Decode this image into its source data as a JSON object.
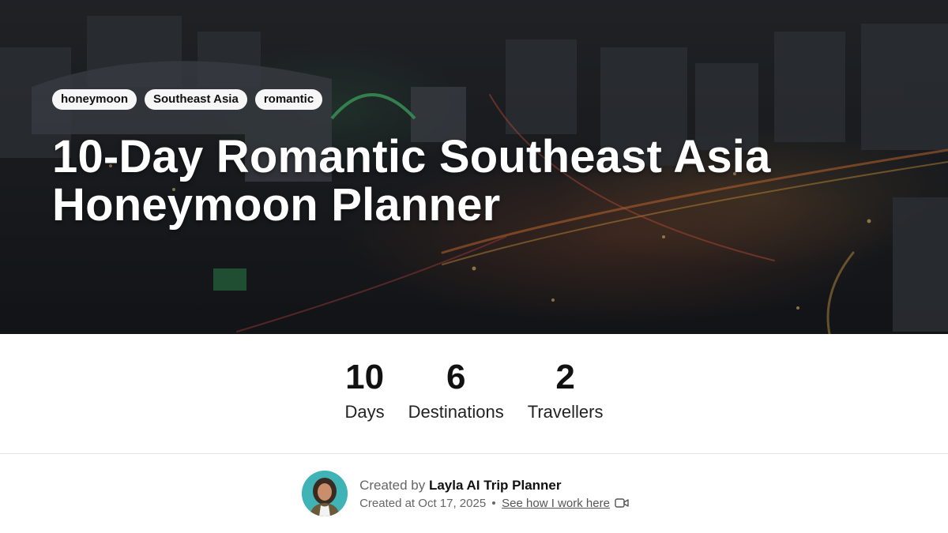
{
  "hero": {
    "tags": [
      "honeymoon",
      "Southeast Asia",
      "romantic"
    ],
    "title": "10-Day Romantic Southeast Asia Honeymoon Planner"
  },
  "stats": [
    {
      "value": "10",
      "label": "Days"
    },
    {
      "value": "6",
      "label": "Destinations"
    },
    {
      "value": "2",
      "label": "Travellers"
    }
  ],
  "creator": {
    "prefix": "Created by",
    "name": "Layla AI Trip Planner",
    "created_at": "Created at Oct 17, 2025",
    "link_label": "See how I work here",
    "link_icon": "video-icon"
  },
  "colors": {
    "avatar_bg": "#3fb3b5",
    "tag_bg": "#f6f6f6"
  }
}
